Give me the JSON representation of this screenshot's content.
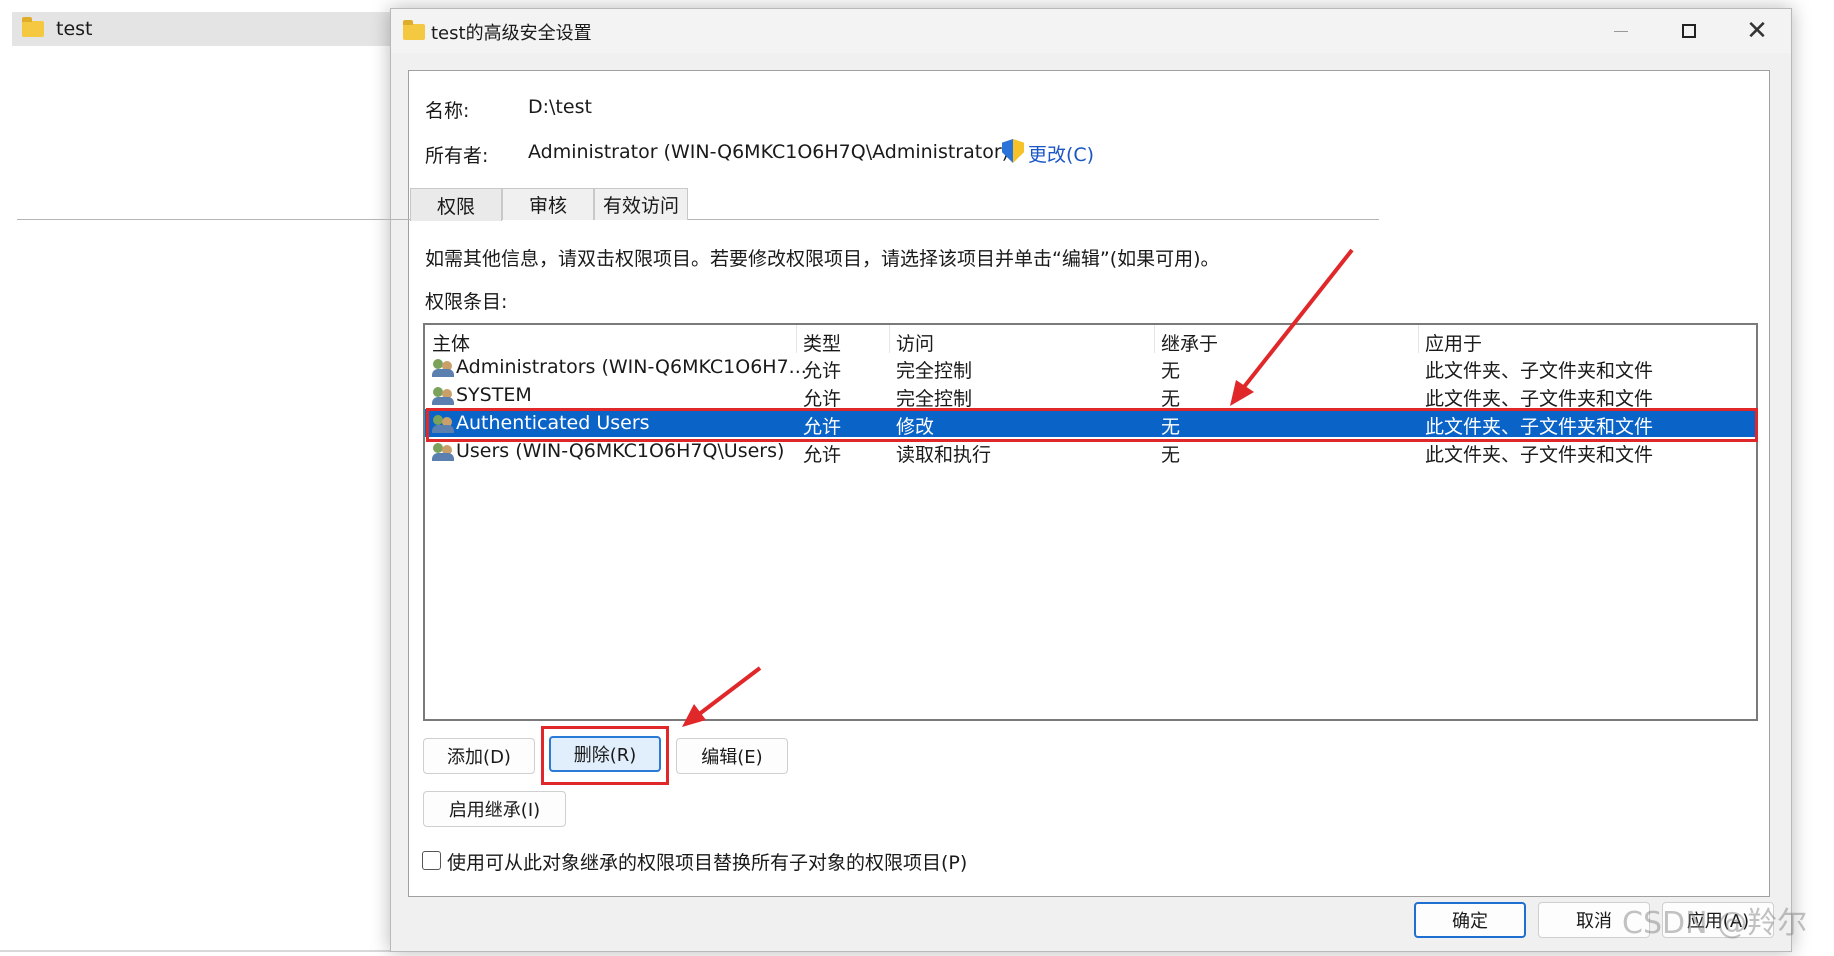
{
  "background": {
    "folder_title": "test"
  },
  "window": {
    "title": "test的高级安全设置",
    "close_glyph": "✕"
  },
  "info": {
    "name_label": "名称:",
    "name_value": "D:\\test",
    "owner_label": "所有者:",
    "owner_value": "Administrator (WIN-Q6MKC1O6H7Q\\Administrator)",
    "change_link": "更改(C)"
  },
  "tabs": [
    {
      "label": "权限"
    },
    {
      "label": "审核"
    },
    {
      "label": "有效访问"
    }
  ],
  "instruction": "如需其他信息，请双击权限项目。若要修改权限项目，请选择该项目并单击“编辑”(如果可用)。",
  "entries_label": "权限条目:",
  "columns": [
    "主体",
    "类型",
    "访问",
    "继承于",
    "应用于"
  ],
  "rows": [
    {
      "principal": "Administrators (WIN-Q6MKC1O6H7...",
      "type": "允许",
      "access": "完全控制",
      "inherited": "无",
      "applies": "此文件夹、子文件夹和文件"
    },
    {
      "principal": "SYSTEM",
      "type": "允许",
      "access": "完全控制",
      "inherited": "无",
      "applies": "此文件夹、子文件夹和文件"
    },
    {
      "principal": "Authenticated Users",
      "type": "允许",
      "access": "修改",
      "inherited": "无",
      "applies": "此文件夹、子文件夹和文件"
    },
    {
      "principal": "Users (WIN-Q6MKC1O6H7Q\\Users)",
      "type": "允许",
      "access": "读取和执行",
      "inherited": "无",
      "applies": "此文件夹、子文件夹和文件"
    }
  ],
  "selected_row": 2,
  "buttons": {
    "add": "添加(D)",
    "remove": "删除(R)",
    "edit": "编辑(E)",
    "enable_inheritance": "启用继承(I)",
    "ok": "确定",
    "cancel": "取消",
    "apply": "应用(A)"
  },
  "replace_checkbox_label": "使用可从此对象继承的权限项目替换所有子对象的权限项目(P)",
  "watermark": "CSDN @羚尔",
  "colors": {
    "selection": "#0a64c8",
    "annotation_red": "#e0282a",
    "link": "#1a56c4"
  }
}
